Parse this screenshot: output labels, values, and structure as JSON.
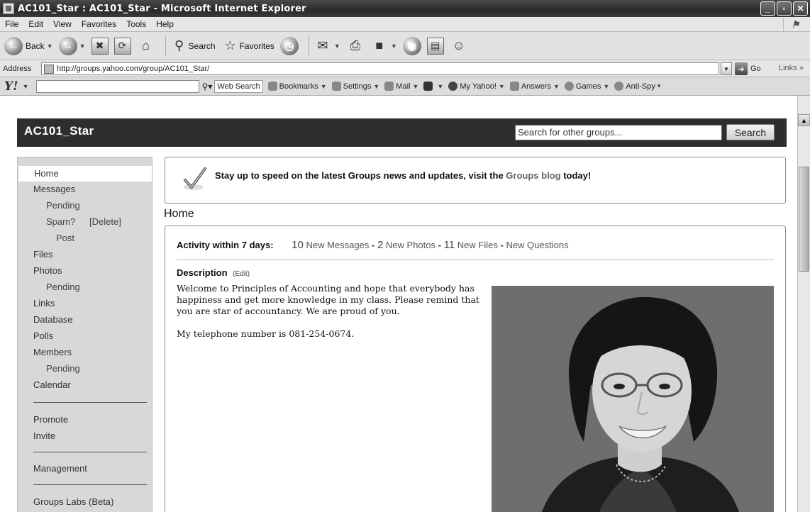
{
  "window": {
    "title": "AC101_Star : AC101_Star - Microsoft Internet Explorer",
    "buttons": [
      "_",
      "▫",
      "✕"
    ]
  },
  "menu": [
    "File",
    "Edit",
    "View",
    "Favorites",
    "Tools",
    "Help"
  ],
  "toolbar": {
    "back_label": "Back",
    "search_label": "Search",
    "favorites_label": "Favorites"
  },
  "address": {
    "label": "Address",
    "url": "http://groups.yahoo.com/group/AC101_Star/",
    "go_label": "Go",
    "links_label": "Links"
  },
  "ytoolbar": {
    "logo": "Y!",
    "web_search": "Web Search",
    "items": [
      "Bookmarks",
      "Settings",
      "Mail",
      "My Yahoo!",
      "Answers",
      "Games",
      "Anti-Spy"
    ]
  },
  "group": {
    "name": "AC101_Star",
    "search_placeholder": "Search for other groups...",
    "search_button": "Search"
  },
  "sidebar": {
    "home": "Home",
    "messages": "Messages",
    "pending1": "Pending",
    "spam": "Spam?",
    "delete": "[Delete]",
    "post": "Post",
    "files": "Files",
    "photos": "Photos",
    "pending2": "Pending",
    "links": "Links",
    "database": "Database",
    "polls": "Polls",
    "members": "Members",
    "pending3": "Pending",
    "calendar": "Calendar",
    "promote": "Promote",
    "invite": "Invite",
    "management": "Management",
    "labs": "Groups Labs (Beta)"
  },
  "notice": {
    "text_before": "Stay up to speed on the latest Groups news and updates, visit the ",
    "blog_link": "Groups blog",
    "text_after": " today!"
  },
  "main": {
    "heading": "Home",
    "activity_label": "Activity within 7 days:",
    "messages_count": "10",
    "messages_label": "New Messages",
    "photos_count": "2",
    "photos_label": "New Photos",
    "files_count": "11",
    "files_label": "New Files",
    "questions_label": "New Questions",
    "description_title": "Description",
    "edit_label": "(Edit)",
    "description": "Welcome to Principles of Accounting and hope that everybody has happiness and get more knowledge in my class. Please remind that you are star of accountancy. We are proud of you.",
    "telephone": "My telephone number is 081-254-0674."
  }
}
